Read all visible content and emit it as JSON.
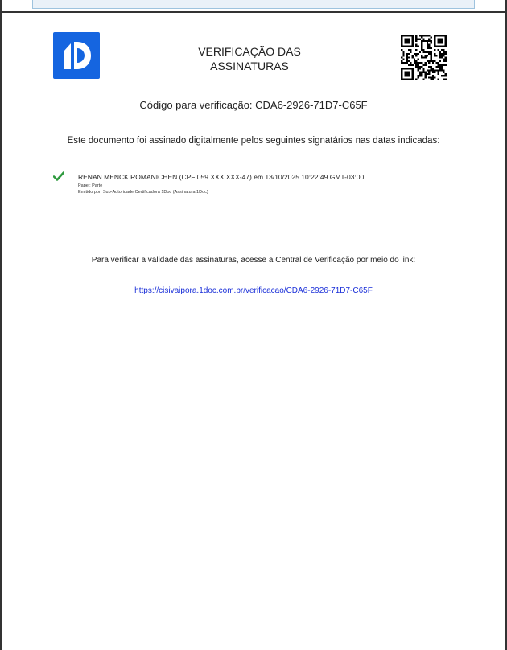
{
  "document": {
    "logo_icon": "1doc-logo-icon",
    "title": "VERIFICAÇÃO DAS ASSINATURAS",
    "qr_icon": "qr-code-icon",
    "verification_code_text": "Código para verificação: CDA6-2926-71D7-C65F",
    "intro_text": "Este documento foi assinado digitalmente pelos seguintes signatários nas datas indicadas:",
    "signatories": [
      {
        "status_icon": "checkmark-icon",
        "name_line": "RENAN MENCK ROMANICHEN (CPF 059.XXX.XXX-47) em 13/10/2025 10:22:49 GMT-03:00",
        "role_line": "Papel: Parte",
        "issuer_line": "Emitido por: Sub-Autoridade Certificadora 1Doc (Assinatura 1Doc)"
      }
    ],
    "verify_instruction": "Para verificar a validade das assinaturas, acesse a Central de Verificação por meio do link:",
    "verify_link": "https://cisivaipora.1doc.com.br/verificacao/CDA6-2926-71D7-C65F"
  },
  "colors": {
    "brand_blue": "#1565e0",
    "link_blue": "#1a2fd8",
    "check_green": "#2e9a3e"
  }
}
